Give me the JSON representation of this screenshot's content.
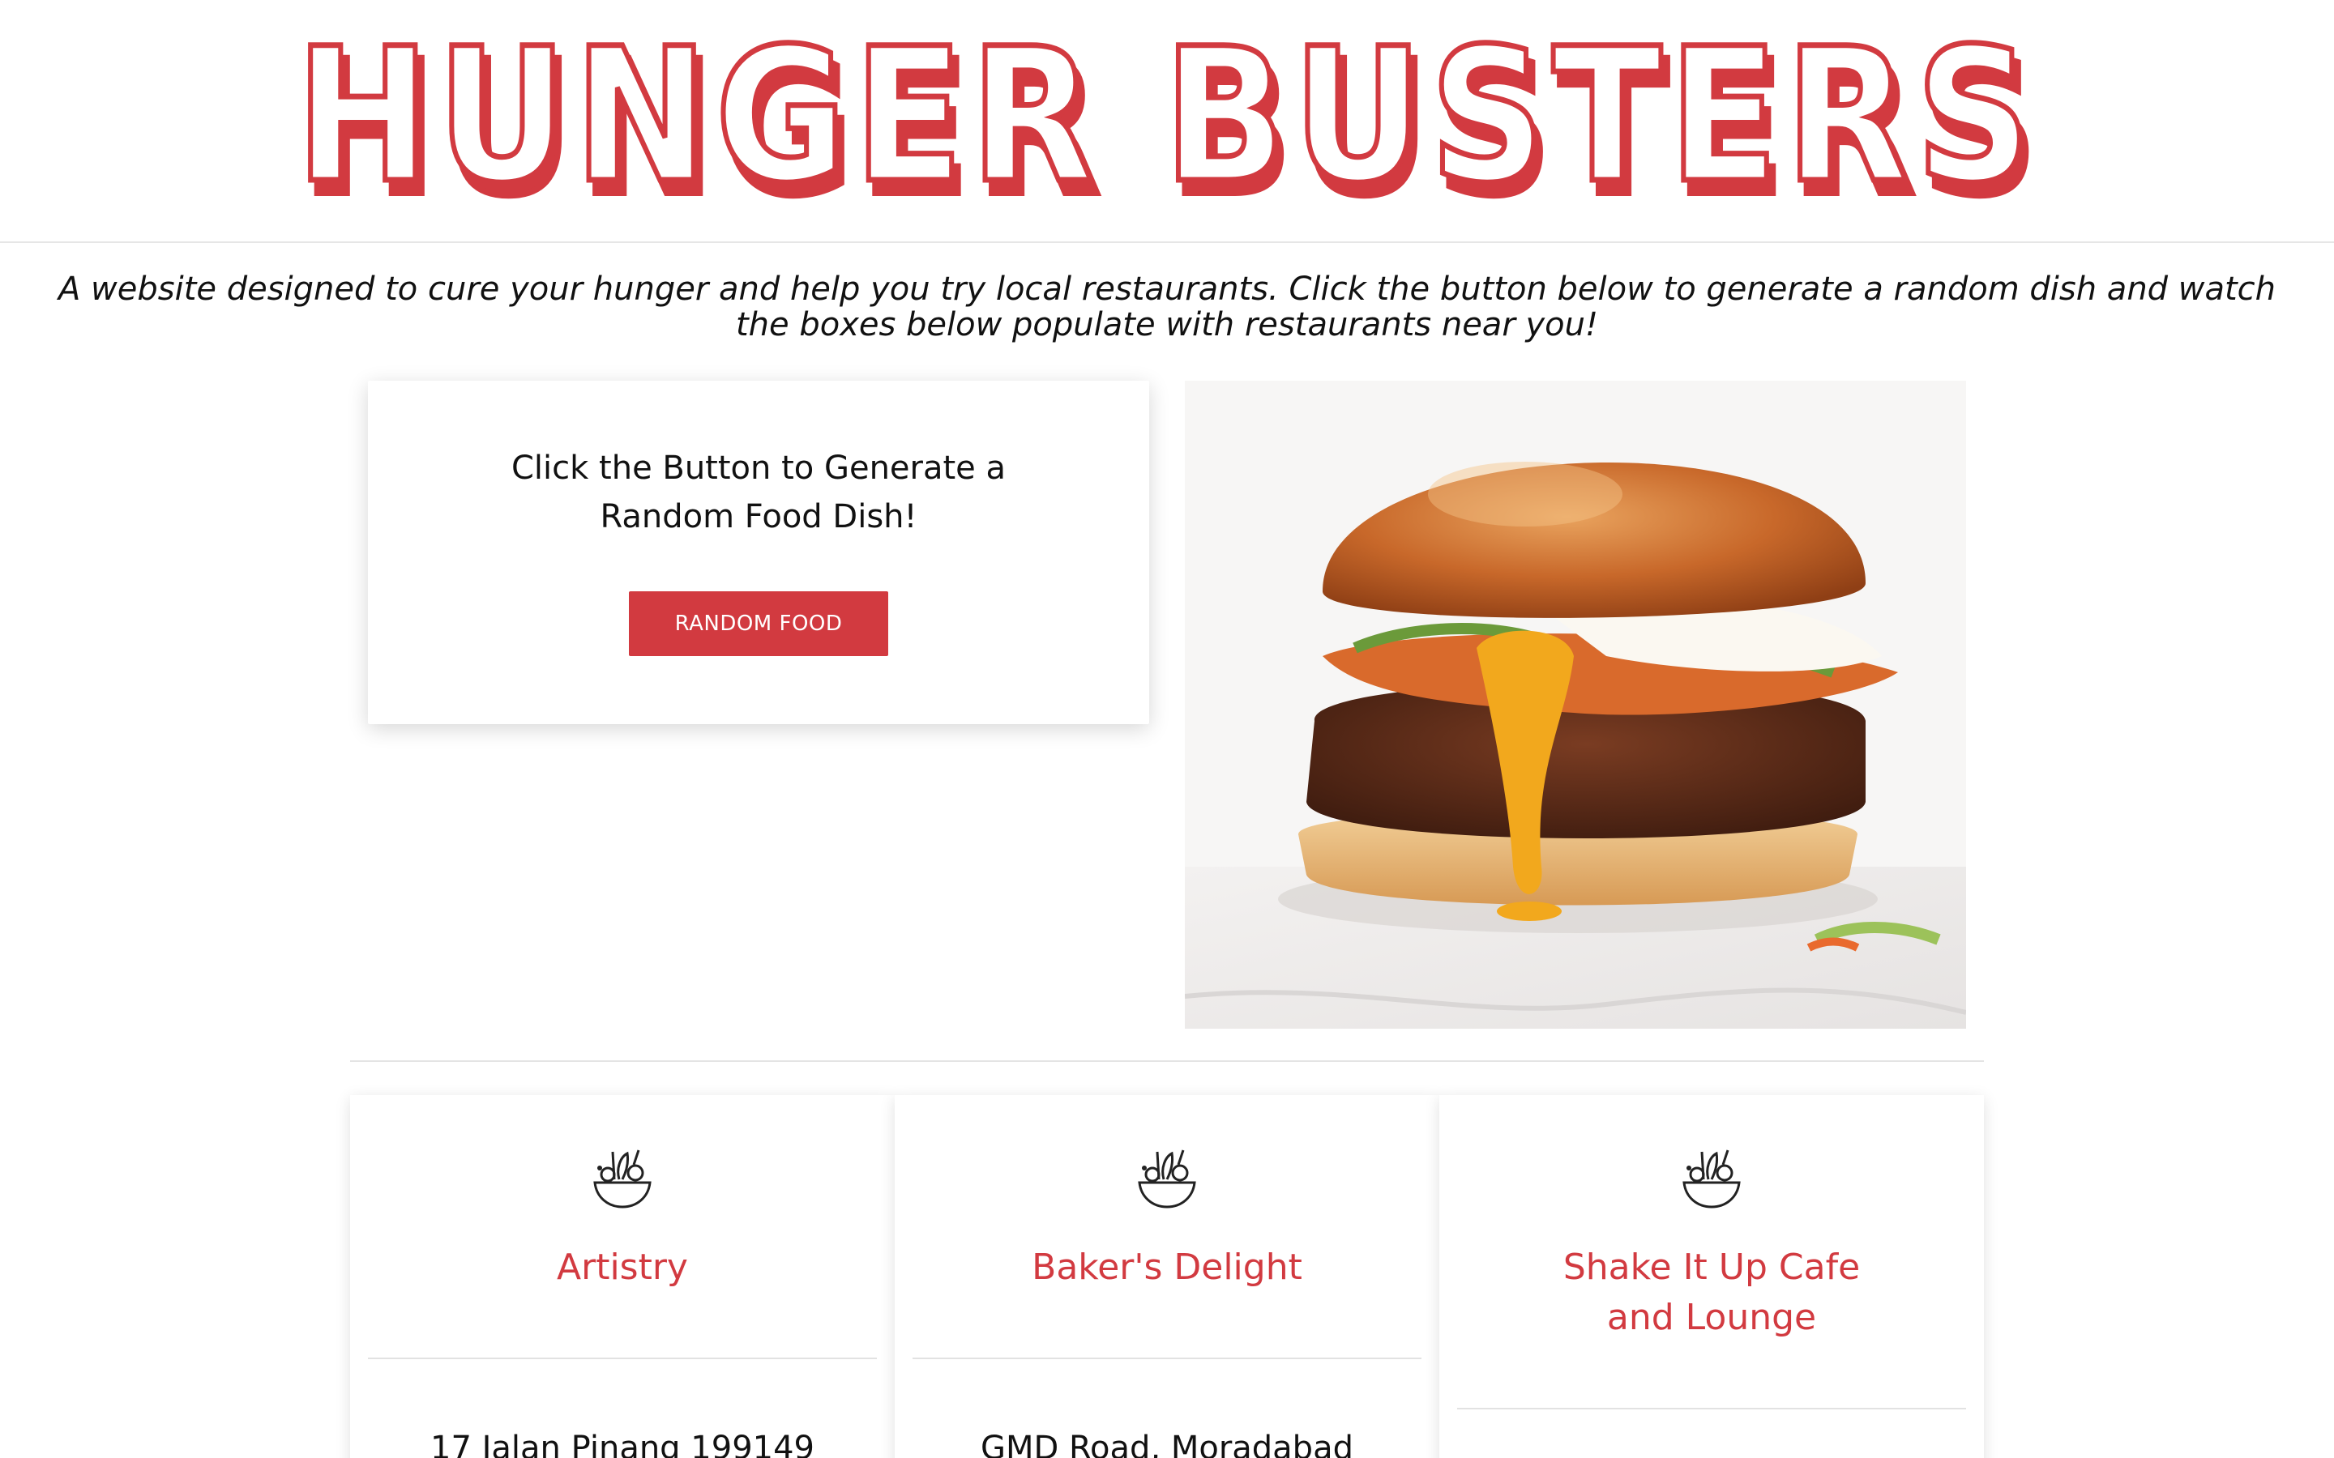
{
  "site": {
    "title": "HUNGER BUSTERS",
    "tagline": "A website designed to cure your hunger and help you try local restaurants. Click the button below to generate a random dish and watch the boxes below populate with restaurants near you!"
  },
  "generator": {
    "prompt": "Click the Button to Generate a Random Food Dish!",
    "button_label": "RANDOM FOOD"
  },
  "hero_image": {
    "icon": "burger-photo",
    "description_visible": false
  },
  "restaurants": [
    {
      "name": "Artistry",
      "address": "17 Jalan Pinang 199149",
      "icon": "salad-bowl-icon"
    },
    {
      "name": "Baker's Delight",
      "address": "GMD Road, Moradabad",
      "icon": "salad-bowl-icon"
    },
    {
      "name": "Shake It Up Cafe and Lounge",
      "address": "",
      "icon": "salad-bowl-icon"
    }
  ],
  "colors": {
    "accent": "#d23a40",
    "text": "#111111",
    "background": "#ffffff"
  }
}
